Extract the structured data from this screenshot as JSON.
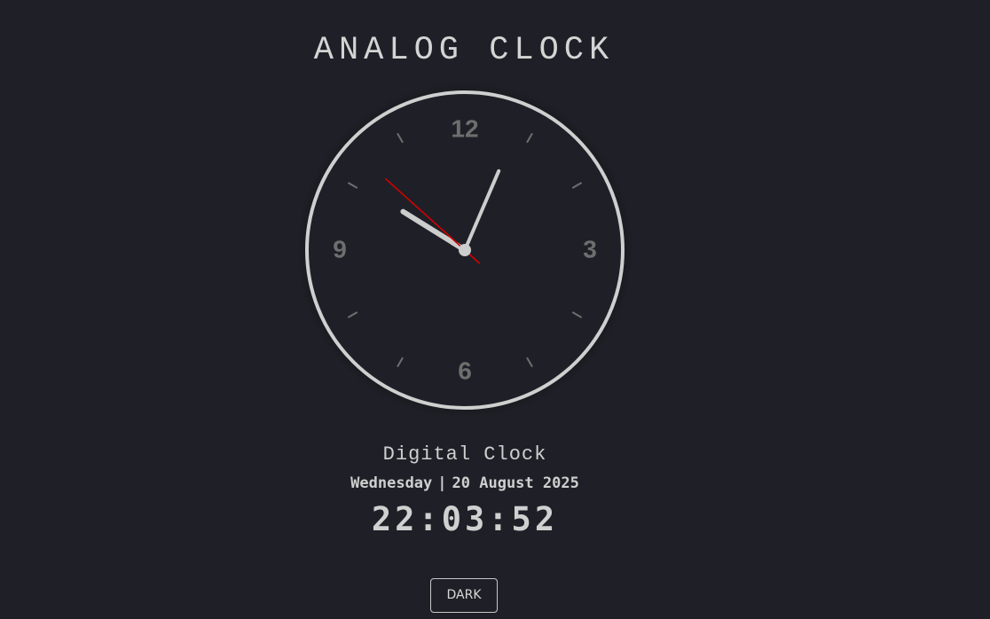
{
  "header": {
    "title": "ANALOG CLOCK"
  },
  "analog_clock": {
    "numerals": {
      "twelve": "12",
      "three": "3",
      "six": "6",
      "nine": "9"
    },
    "time": {
      "hours": 22,
      "minutes": 3,
      "seconds": 52
    },
    "colors": {
      "rim": "#cfcfcf",
      "face": "#1f2027",
      "numerals": "#6e6e6e",
      "ticks": "#6e6e6e",
      "hands": "#cdcdcd",
      "second_hand": "#d40000"
    }
  },
  "digital_clock": {
    "label": "Digital Clock",
    "weekday": "Wednesday",
    "separator": "|",
    "date": "20 August 2025",
    "time": "22:03:52"
  },
  "controls": {
    "mode_button_label": "DARK"
  }
}
